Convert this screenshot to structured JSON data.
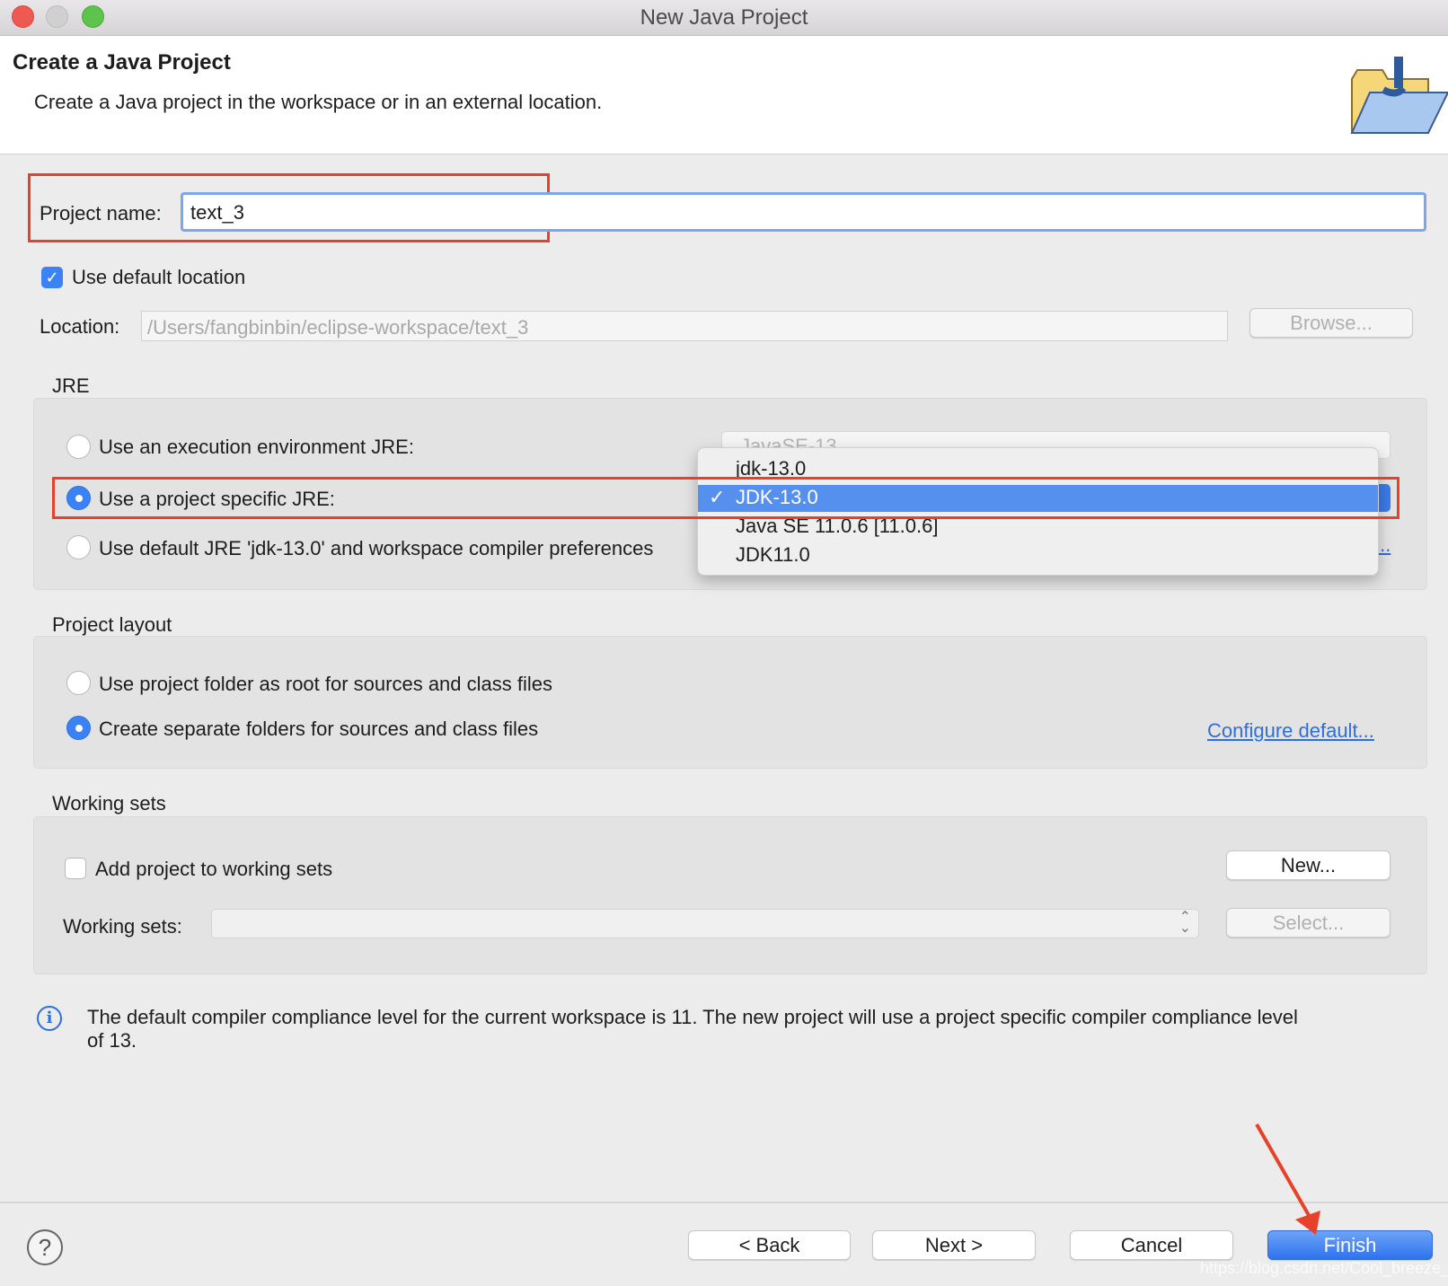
{
  "window": {
    "title": "New Java Project"
  },
  "header": {
    "title": "Create a Java Project",
    "subtitle": "Create a Java project in the workspace or in an external location."
  },
  "project_name": {
    "label": "Project name:",
    "value": "text_3"
  },
  "default_location": {
    "label": "Use default location",
    "checked": true
  },
  "location": {
    "label": "Location:",
    "value": "/Users/fangbinbin/eclipse-workspace/text_3",
    "browse": "Browse..."
  },
  "jre": {
    "title": "JRE",
    "option_env": "Use an execution environment JRE:",
    "env_value": "JavaSE-13",
    "option_specific": "Use a project specific JRE:",
    "option_default": "Use default JRE 'jdk-13.0' and workspace compiler preferences",
    "selected": "specific",
    "link_partial": "...",
    "dropdown": {
      "items": [
        "jdk-13.0",
        "JDK-13.0",
        "Java SE 11.0.6 [11.0.6]",
        "JDK11.0"
      ],
      "selected": "JDK-13.0",
      "check": "✓"
    }
  },
  "layout": {
    "title": "Project layout",
    "option_root": "Use project folder as root for sources and class files",
    "option_separate": "Create separate folders for sources and class files",
    "selected": "separate",
    "configure": "Configure default..."
  },
  "working_sets": {
    "title": "Working sets",
    "add_label": "Add project to working sets",
    "checked": false,
    "new": "New...",
    "label": "Working sets:",
    "value": "",
    "select": "Select..."
  },
  "info": {
    "line1": "The default compiler compliance level for the current workspace is 11. The new project will use a project specific compiler compliance level",
    "line2": "of 13."
  },
  "footer": {
    "help": "?",
    "back": "< Back",
    "next": "Next >",
    "cancel": "Cancel",
    "finish": "Finish"
  },
  "watermark": "https://blog.csdn.net/Cool_breeze_bin",
  "colors": {
    "accent": "#3b82f6",
    "annotation": "#e8412a",
    "selection": "#5690ef"
  }
}
